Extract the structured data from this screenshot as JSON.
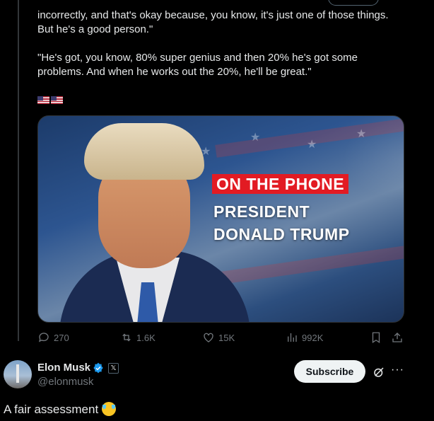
{
  "tweet": {
    "quote_lines": [
      "incorrectly, and that's okay because, you know, it's just one of those things.",
      "But he's a good person.\"",
      "\"He's got, you know, 80% super genius and then 20% he's got some",
      "problems. And when he works out the 20%, he'll be great.\""
    ],
    "flags": "🇺🇸🇺🇸",
    "media": {
      "headline_red": "ON THE PHONE",
      "headline_line1": "PRESIDENT",
      "headline_line2": "DONALD TRUMP",
      "colors": {
        "accent_red": "#e21b23",
        "flag_blue": "#2d5590"
      }
    },
    "actions": {
      "replies": "270",
      "reposts": "1.6K",
      "likes": "15K",
      "views": "992K"
    }
  },
  "reply": {
    "name": "Elon Musk",
    "handle": "@elonmusk",
    "verified_color": "#1d9bf0",
    "affiliate_badge": "𝕏",
    "subscribe_label": "Subscribe",
    "more_label": "···",
    "text": "A fair assessment"
  }
}
